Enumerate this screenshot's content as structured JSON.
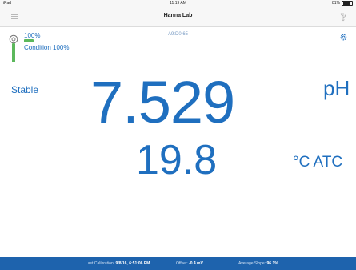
{
  "status_bar": {
    "left": "iPad",
    "time": "11:19 AM",
    "battery_text": "81%"
  },
  "nav": {
    "title": "Hanna Lab"
  },
  "probe": {
    "percent": "100%",
    "percent_value": 100,
    "condition": "Condition 100%",
    "color": "#5cb85c"
  },
  "device_id": "A9:D0:65",
  "measurement": {
    "stability": "Stable",
    "value": "7.529",
    "unit": "pH",
    "temperature": "19.8",
    "temperature_unit": "°C ATC"
  },
  "footer": {
    "last_calibration_label": "Last Calibration:",
    "last_calibration_value": "9/8/16, 6:51:06 PM",
    "offset_label": "Offset:",
    "offset_value": "-0.4 mV",
    "slope_label": "Average Slope:",
    "slope_value": "96.1%"
  },
  "colors": {
    "accent": "#1f6fbf",
    "footer_bg": "#1e63ad",
    "status_ok": "#5cb85c"
  },
  "icons": [
    "menu-icon",
    "usb-icon",
    "probe-icon",
    "gear-icon",
    "battery-icon"
  ]
}
